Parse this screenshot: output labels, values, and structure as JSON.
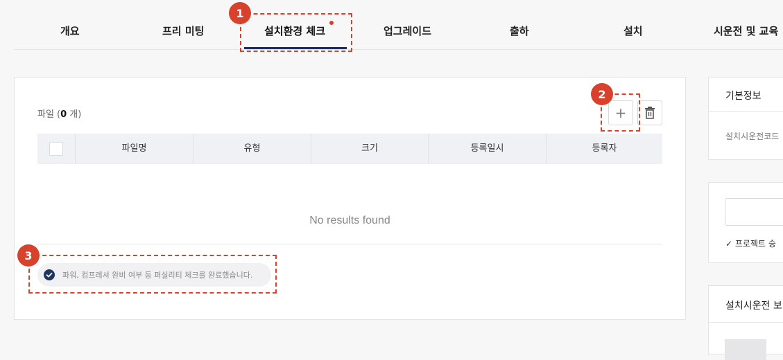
{
  "tabs": [
    {
      "label": "개요"
    },
    {
      "label": "프리 미팅"
    },
    {
      "label": "설치환경 체크"
    },
    {
      "label": "업그레이드"
    },
    {
      "label": "출하"
    },
    {
      "label": "설치"
    },
    {
      "label": "시운전 및 교육"
    }
  ],
  "active_tab": "설치환경 체크",
  "files": {
    "label_prefix": "파일 (",
    "count": "0",
    "label_suffix": " 개)",
    "add_icon": "plus-icon",
    "delete_icon": "trash-icon",
    "columns": [
      "파일명",
      "유형",
      "크기",
      "등록일시",
      "등록자"
    ],
    "empty_text": "No results found"
  },
  "completion": {
    "text": "파워, 컴프레셔 완비 여부 등 퍼실리티 체크를 완료했습니다.",
    "icon": "check-circle-icon"
  },
  "markers": [
    "1",
    "2",
    "3"
  ],
  "side": {
    "basic_info_title": "기본정보",
    "code_label": "설치시운전코드",
    "project_check": "프로젝트 승",
    "report_title": "설치시운전 보"
  },
  "colors": {
    "accent": "#1f2b5c",
    "marker": "#d8412c",
    "check": "#1f3561"
  }
}
